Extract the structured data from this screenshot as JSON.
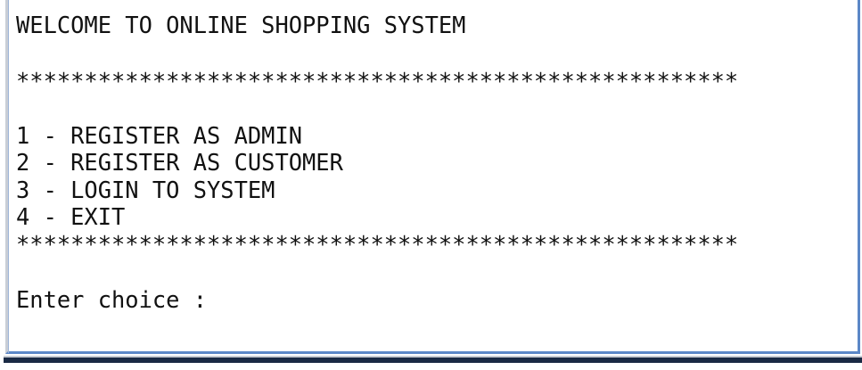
{
  "console": {
    "title_line": "WELCOME TO ONLINE SHOPPING SYSTEM",
    "separator_top": "*****************************************************",
    "menu": [
      {
        "label": "1 - REGISTER AS ADMIN"
      },
      {
        "label": "2 - REGISTER AS CUSTOMER"
      },
      {
        "label": "3 - LOGIN TO SYSTEM"
      },
      {
        "label": "4 - EXIT"
      }
    ],
    "separator_bottom": "*****************************************************",
    "prompt": "Enter choice :"
  }
}
